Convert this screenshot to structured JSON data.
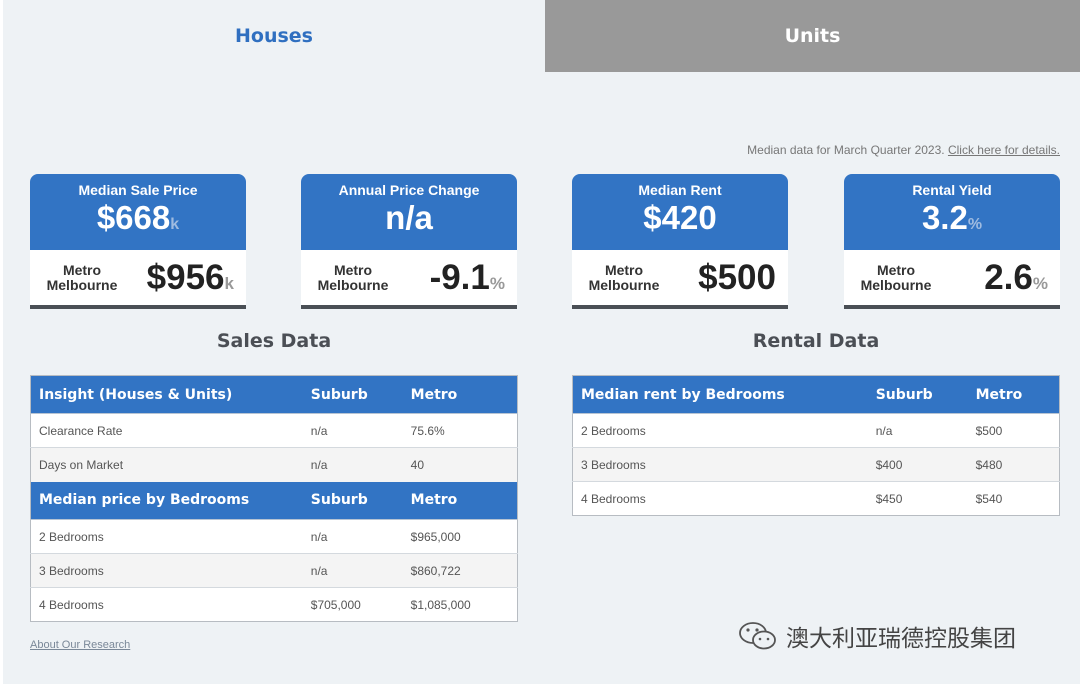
{
  "tabs": {
    "houses": "Houses",
    "units": "Units"
  },
  "note": {
    "text": "Median data for March Quarter 2023.",
    "link": "Click here for details."
  },
  "cards": [
    {
      "title": "Median Sale Price",
      "value": "$668",
      "value_unit": "k",
      "bottom_label": "Metro Melbourne",
      "bottom_value": "$956",
      "bottom_unit": "k"
    },
    {
      "title": "Annual Price Change",
      "value": "n/a",
      "value_unit": "",
      "bottom_label": "Metro Melbourne",
      "bottom_value": "-9.1",
      "bottom_unit": "%"
    },
    {
      "title": "Median Rent",
      "value": "$420",
      "value_unit": "",
      "bottom_label": "Metro Melbourne",
      "bottom_value": "$500",
      "bottom_unit": ""
    },
    {
      "title": "Rental Yield",
      "value": "3.2",
      "value_unit": "%",
      "bottom_label": "Metro Melbourne",
      "bottom_value": "2.6",
      "bottom_unit": "%"
    }
  ],
  "sales": {
    "title": "Sales Data",
    "insight_headers": [
      "Insight (Houses & Units)",
      "Suburb",
      "Metro"
    ],
    "insight_rows": [
      [
        "Clearance Rate",
        "n/a",
        "75.6%"
      ],
      [
        "Days on Market",
        "n/a",
        "40"
      ]
    ],
    "bed_headers": [
      "Median price by Bedrooms",
      "Suburb",
      "Metro"
    ],
    "bed_rows": [
      [
        "2 Bedrooms",
        "n/a",
        "$965,000"
      ],
      [
        "3 Bedrooms",
        "n/a",
        "$860,722"
      ],
      [
        "4 Bedrooms",
        "$705,000",
        "$1,085,000"
      ]
    ]
  },
  "rental": {
    "title": "Rental Data",
    "headers": [
      "Median rent by Bedrooms",
      "Suburb",
      "Metro"
    ],
    "rows": [
      [
        "2 Bedrooms",
        "n/a",
        "$500"
      ],
      [
        "3 Bedrooms",
        "$400",
        "$480"
      ],
      [
        "4 Bedrooms",
        "$450",
        "$540"
      ]
    ]
  },
  "about_link": "About Our Research",
  "watermark": {
    "text": "澳大利亚瑞德控股集团",
    "icon": "wechat-icon"
  }
}
